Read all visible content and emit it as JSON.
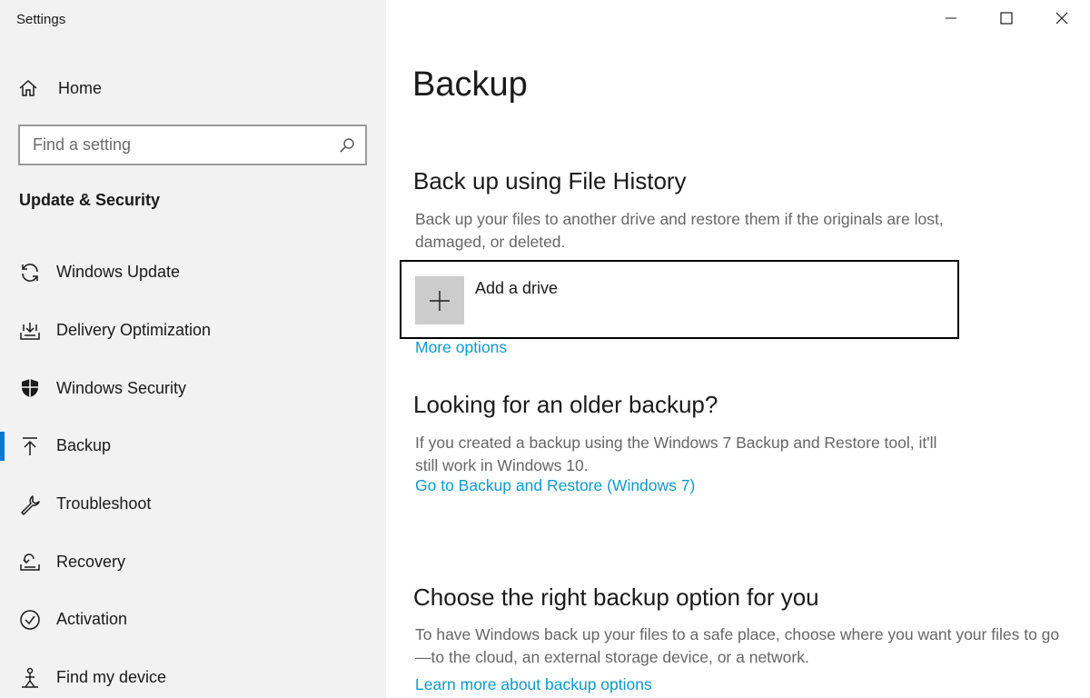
{
  "window": {
    "title": "Settings"
  },
  "sidebar": {
    "home_label": "Home",
    "search": {
      "placeholder": "Find a setting"
    },
    "section_title": "Update & Security",
    "items": [
      {
        "label": "Windows Update",
        "icon": "sync-icon"
      },
      {
        "label": "Delivery Optimization",
        "icon": "delivery-optimization-icon"
      },
      {
        "label": "Windows Security",
        "icon": "shield-icon"
      },
      {
        "label": "Backup",
        "icon": "backup-arrow-icon",
        "active": true
      },
      {
        "label": "Troubleshoot",
        "icon": "wrench-icon"
      },
      {
        "label": "Recovery",
        "icon": "recovery-icon"
      },
      {
        "label": "Activation",
        "icon": "check-circle-icon"
      },
      {
        "label": "Find my device",
        "icon": "person-location-icon"
      }
    ]
  },
  "main": {
    "title": "Backup",
    "file_history": {
      "heading": "Back up using File History",
      "description": "Back up your files to another drive and restore them if the originals are lost, damaged, or deleted.",
      "add_drive_label": "Add a drive",
      "more_options_link": "More options"
    },
    "older_backup": {
      "heading": "Looking for an older backup?",
      "description": "If you created a backup using the Windows 7 Backup and Restore tool, it'll still work in Windows 10.",
      "link": "Go to Backup and Restore (Windows 7)"
    },
    "choose_option": {
      "heading": "Choose the right backup option for you",
      "description": "To have Windows back up your files to a safe place, choose where you want your files to go—to the cloud, an external storage device, or a network.",
      "link": "Learn more about backup options"
    }
  },
  "colors": {
    "accent": "#0078d7",
    "link": "#0e9ac9",
    "sidebar_bg": "#f2f2f2",
    "muted_text": "#666666"
  }
}
